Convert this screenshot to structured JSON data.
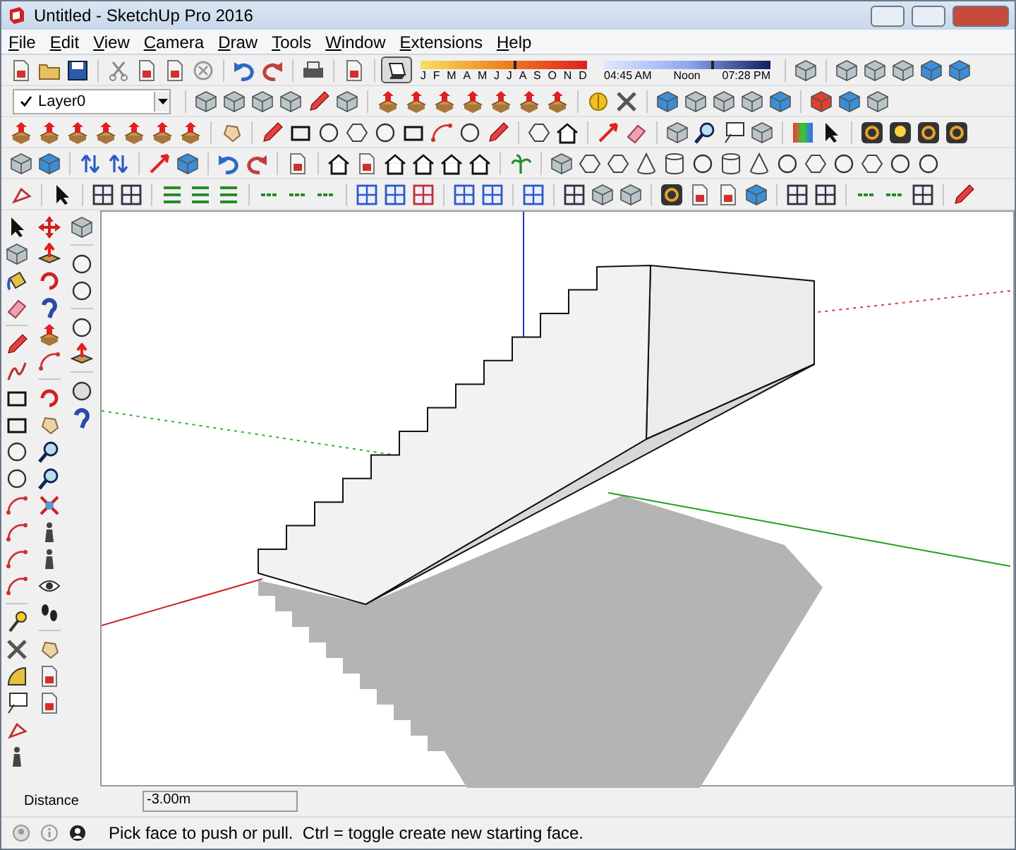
{
  "window": {
    "title": "Untitled - SketchUp Pro 2016"
  },
  "menu": [
    {
      "label": "File"
    },
    {
      "label": "Edit"
    },
    {
      "label": "View"
    },
    {
      "label": "Camera"
    },
    {
      "label": "Draw"
    },
    {
      "label": "Tools"
    },
    {
      "label": "Window"
    },
    {
      "label": "Extensions"
    },
    {
      "label": "Help"
    }
  ],
  "shadows": {
    "on": true,
    "months": [
      "J",
      "F",
      "M",
      "A",
      "M",
      "J",
      "J",
      "A",
      "S",
      "O",
      "N",
      "D"
    ],
    "date_slider": {
      "level": 0.58
    },
    "time_labels": [
      "04:45 AM",
      "Noon",
      "07:28 PM"
    ],
    "time_slider": {
      "level": 0.66
    }
  },
  "layer": {
    "name": "Layer0",
    "checked": true
  },
  "measurements": {
    "label": "Distance",
    "value": "-3.00m"
  },
  "status_bar": {
    "message": "Pick face to push or pull.  Ctrl = toggle create new starting face."
  }
}
